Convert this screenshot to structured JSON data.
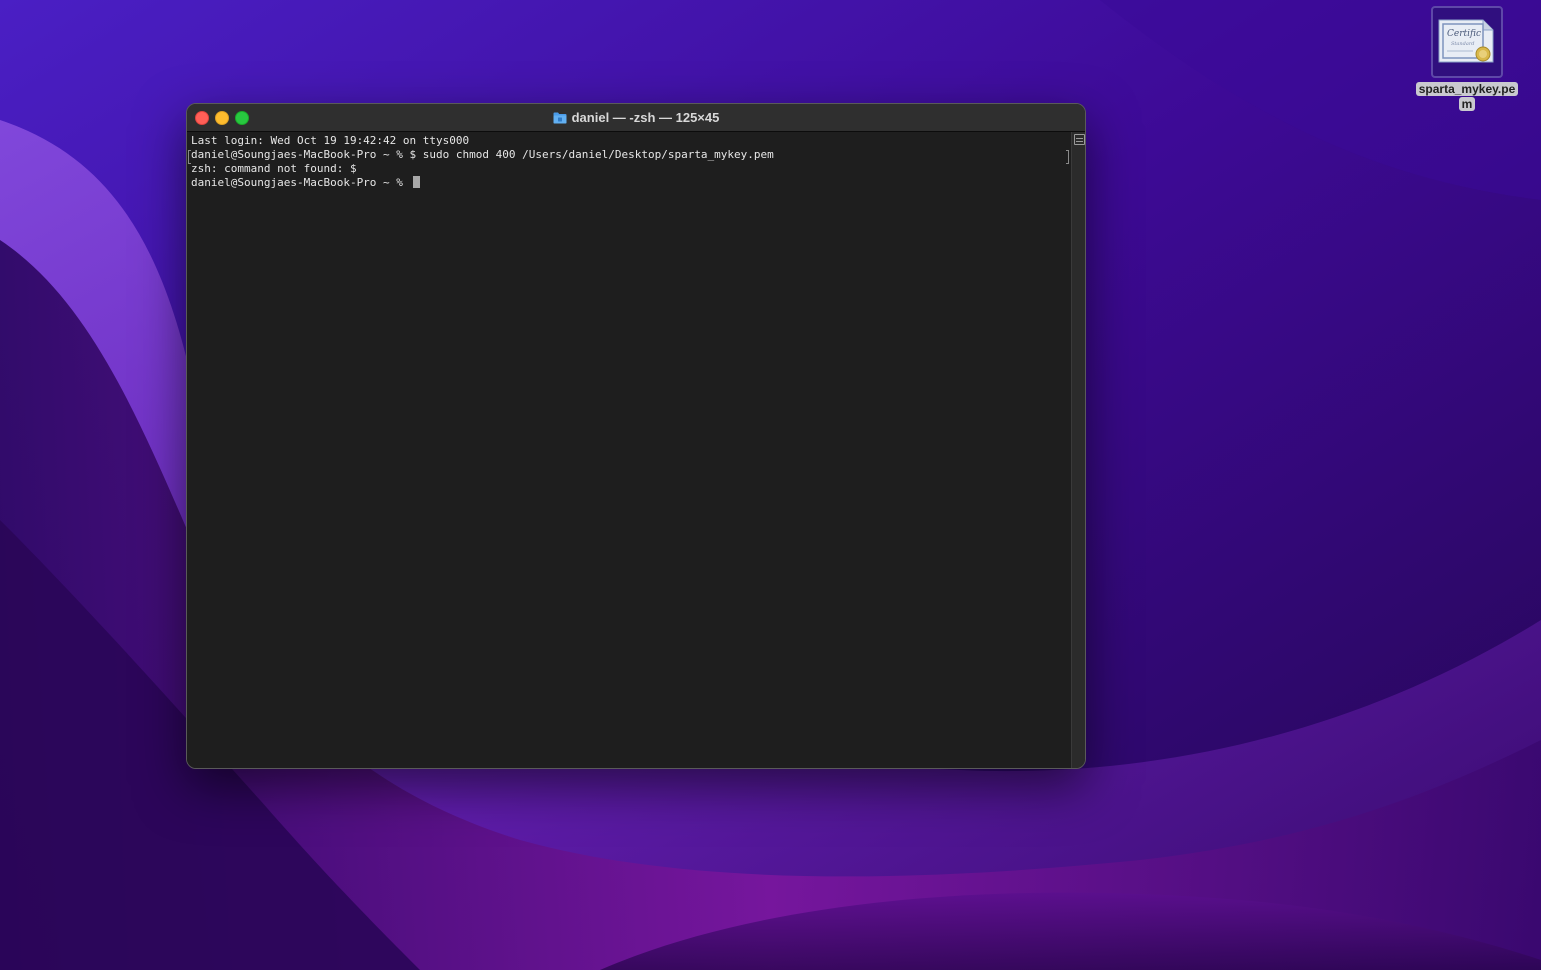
{
  "desktop": {
    "file": {
      "name": "sparta_mykey.pem",
      "label_line1": "sparta_mykey.pe",
      "label_line2": "m",
      "icon": "certificate-icon"
    }
  },
  "terminal": {
    "title": "daniel — -zsh — 125×45",
    "title_icon": "folder-icon",
    "lines": [
      "Last login: Wed Oct 19 19:42:42 on ttys000",
      "daniel@Soungjaes-MacBook-Pro ~ % $ sudo chmod 400 /Users/daniel/Desktop/sparta_mykey.pem",
      "zsh: command not found: $",
      "daniel@Soungjaes-MacBook-Pro ~ % "
    ],
    "traffic_lights": {
      "close": "#ff5f57",
      "minimize": "#febc2e",
      "zoom": "#28c840"
    },
    "background": "#1e1e1e",
    "text_color": "#e6e6e6"
  }
}
